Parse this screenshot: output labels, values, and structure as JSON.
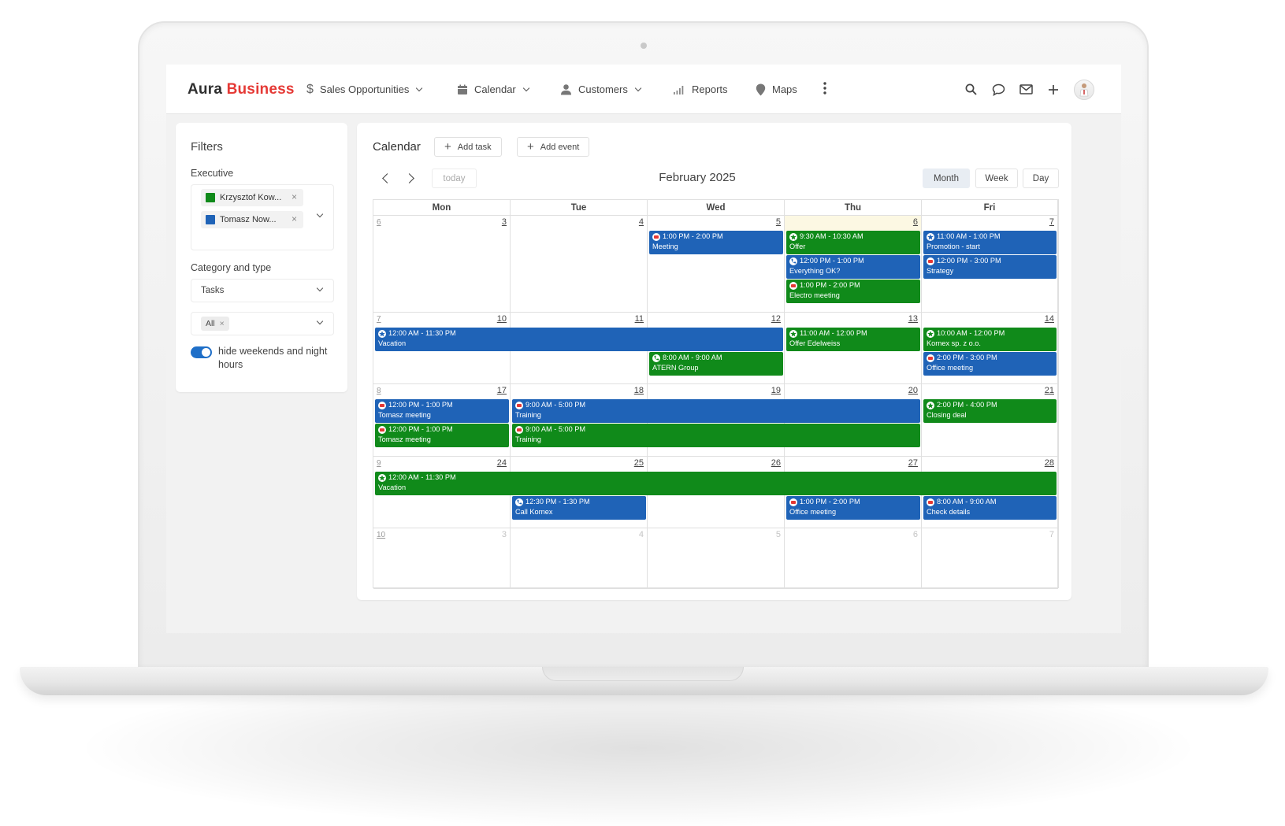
{
  "app": {
    "logo_main": "Aura",
    "logo_accent": "Business",
    "colors": {
      "accent": "#e53935",
      "blue": "#1f63b7",
      "green": "#108a1a"
    }
  },
  "nav": {
    "items": [
      {
        "label": "Sales Opportunities",
        "icon": "dollar-icon",
        "dropdown": true
      },
      {
        "label": "Calendar",
        "icon": "calendar-icon",
        "dropdown": true
      },
      {
        "label": "Customers",
        "icon": "person-icon",
        "dropdown": true
      },
      {
        "label": "Reports",
        "icon": "bar-chart-icon",
        "dropdown": false
      },
      {
        "label": "Maps",
        "icon": "map-pin-icon",
        "dropdown": false
      }
    ],
    "right_icons": [
      "search-icon",
      "chat-icon",
      "mail-icon",
      "plus-icon",
      "avatar"
    ]
  },
  "filters": {
    "title": "Filters",
    "executive_label": "Executive",
    "executives": [
      {
        "name": "Krzysztof Kow...",
        "color": "#108a1a"
      },
      {
        "name": "Tomasz Now...",
        "color": "#1f63b7"
      }
    ],
    "category_label": "Category and type",
    "category_value": "Tasks",
    "type_chip": "All",
    "toggle_label": "hide weekends and night hours",
    "toggle_on": true
  },
  "calendar": {
    "title": "Calendar",
    "add_task": "Add task",
    "add_event": "Add event",
    "today": "today",
    "month_title": "February 2025",
    "views": [
      "Month",
      "Week",
      "Day"
    ],
    "active_view": "Month",
    "weekdays": [
      "Mon",
      "Tue",
      "Wed",
      "Thu",
      "Fri"
    ],
    "weeks": [
      {
        "week_no": "6",
        "days": [
          "3",
          "4",
          "5",
          "6",
          "7"
        ],
        "muted": [
          false,
          false,
          false,
          false,
          false
        ]
      },
      {
        "week_no": "7",
        "days": [
          "10",
          "11",
          "12",
          "13",
          "14"
        ],
        "muted": [
          false,
          false,
          false,
          false,
          false
        ]
      },
      {
        "week_no": "8",
        "days": [
          "17",
          "18",
          "19",
          "20",
          "21"
        ],
        "muted": [
          false,
          false,
          false,
          false,
          false
        ]
      },
      {
        "week_no": "9",
        "days": [
          "24",
          "25",
          "26",
          "27",
          "28"
        ],
        "muted": [
          false,
          false,
          false,
          false,
          false
        ]
      },
      {
        "week_no": "10",
        "days": [
          "3",
          "4",
          "5",
          "6",
          "7"
        ],
        "muted": [
          true,
          true,
          true,
          true,
          true
        ]
      }
    ],
    "today_cell": {
      "week": 0,
      "day": 3
    },
    "events": [
      {
        "week": 0,
        "day": 2,
        "span": 1,
        "slot": 0,
        "color": "blue",
        "kind": "meeting",
        "time": "1:00 PM - 2:00 PM",
        "title": "Meeting"
      },
      {
        "week": 0,
        "day": 3,
        "span": 1,
        "slot": 0,
        "color": "green",
        "kind": "star",
        "time": "9:30 AM - 10:30 AM",
        "title": "Offer"
      },
      {
        "week": 0,
        "day": 3,
        "span": 1,
        "slot": 1,
        "color": "blue",
        "kind": "phone",
        "time": "12:00 PM - 1:00 PM",
        "title": "Everything OK?"
      },
      {
        "week": 0,
        "day": 3,
        "span": 1,
        "slot": 2,
        "color": "green",
        "kind": "meeting",
        "time": "1:00 PM - 2:00 PM",
        "title": "Electro meeting"
      },
      {
        "week": 0,
        "day": 4,
        "span": 1,
        "slot": 0,
        "color": "blue",
        "kind": "star",
        "time": "11:00 AM - 1:00 PM",
        "title": "Promotion - start"
      },
      {
        "week": 0,
        "day": 4,
        "span": 1,
        "slot": 1,
        "color": "blue",
        "kind": "meeting",
        "time": "12:00 PM - 3:00 PM",
        "title": "Strategy"
      },
      {
        "week": 1,
        "day": 0,
        "span": 3,
        "slot": 0,
        "color": "blue",
        "kind": "star",
        "time": "12:00 AM - 11:30 PM",
        "title": "Vacation"
      },
      {
        "week": 1,
        "day": 3,
        "span": 1,
        "slot": 0,
        "color": "green",
        "kind": "star",
        "time": "11:00 AM - 12:00 PM",
        "title": "Offer Edelweiss"
      },
      {
        "week": 1,
        "day": 4,
        "span": 1,
        "slot": 0,
        "color": "green",
        "kind": "star",
        "time": "10:00 AM - 12:00 PM",
        "title": "Kornex sp. z o.o."
      },
      {
        "week": 1,
        "day": 2,
        "span": 1,
        "slot": 1,
        "color": "green",
        "kind": "phone",
        "time": "8:00 AM - 9:00 AM",
        "title": "ATERN Group"
      },
      {
        "week": 1,
        "day": 4,
        "span": 1,
        "slot": 1,
        "color": "blue",
        "kind": "meeting",
        "time": "2:00 PM - 3:00 PM",
        "title": "Office meeting"
      },
      {
        "week": 2,
        "day": 0,
        "span": 1,
        "slot": 0,
        "color": "blue",
        "kind": "meeting",
        "time": "12:00 PM - 1:00 PM",
        "title": "Tomasz meeting"
      },
      {
        "week": 2,
        "day": 1,
        "span": 3,
        "slot": 0,
        "color": "blue",
        "kind": "meeting",
        "time": "9:00 AM - 5:00 PM",
        "title": "Training"
      },
      {
        "week": 2,
        "day": 4,
        "span": 1,
        "slot": 0,
        "color": "green",
        "kind": "star",
        "time": "2:00 PM - 4:00 PM",
        "title": "Closing deal"
      },
      {
        "week": 2,
        "day": 0,
        "span": 1,
        "slot": 1,
        "color": "green",
        "kind": "meeting",
        "time": "12:00 PM - 1:00 PM",
        "title": "Tomasz meeting"
      },
      {
        "week": 2,
        "day": 1,
        "span": 3,
        "slot": 1,
        "color": "green",
        "kind": "meeting",
        "time": "9:00 AM - 5:00 PM",
        "title": "Training"
      },
      {
        "week": 3,
        "day": 0,
        "span": 5,
        "slot": 0,
        "color": "green",
        "kind": "star",
        "time": "12:00 AM - 11:30 PM",
        "title": "Vacation"
      },
      {
        "week": 3,
        "day": 1,
        "span": 1,
        "slot": 1,
        "color": "blue",
        "kind": "phone",
        "time": "12:30 PM - 1:30 PM",
        "title": "Call Kornex"
      },
      {
        "week": 3,
        "day": 3,
        "span": 1,
        "slot": 1,
        "color": "blue",
        "kind": "meeting",
        "time": "1:00 PM - 2:00 PM",
        "title": "Office meeting"
      },
      {
        "week": 3,
        "day": 4,
        "span": 1,
        "slot": 1,
        "color": "blue",
        "kind": "meeting",
        "time": "8:00 AM - 9:00 AM",
        "title": "Check details"
      }
    ]
  }
}
